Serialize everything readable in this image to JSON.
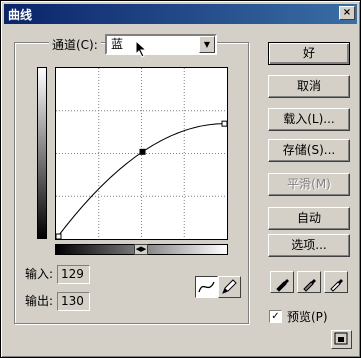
{
  "window": {
    "title": "曲线",
    "close_glyph": "×"
  },
  "channel": {
    "label": "通道(C):",
    "value": "蓝"
  },
  "fields": {
    "input_label": "输入:",
    "input_value": "129",
    "output_label": "输出:",
    "output_value": "130"
  },
  "buttons": {
    "ok": "好",
    "cancel": "取消",
    "load": "载入(L)...",
    "save": "存储(S)...",
    "smooth": "平滑(M)",
    "auto": "自动",
    "options": "选项..."
  },
  "preview": {
    "label": "预览(P)",
    "checked": true,
    "check_glyph": "✓"
  },
  "icons": {
    "curve_tool": "curve-icon",
    "pencil_tool": "pencil-icon",
    "black_eyedropper": "eyedropper-black-icon",
    "gray_eyedropper": "eyedropper-gray-icon",
    "white_eyedropper": "eyedropper-white-icon",
    "expand": "expand-icon"
  },
  "curve": {
    "points": [
      [
        0,
        0
      ],
      [
        129,
        130
      ],
      [
        255,
        172
      ]
    ]
  }
}
